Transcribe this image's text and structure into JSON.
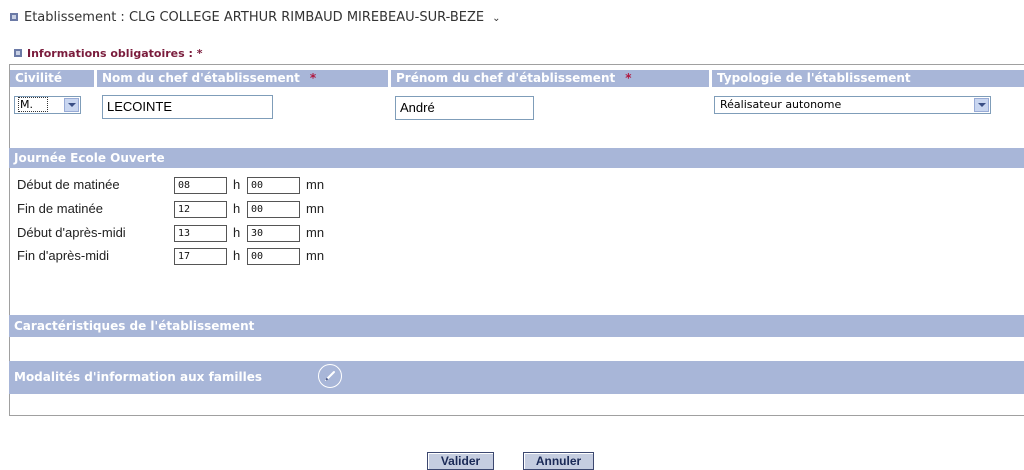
{
  "header": {
    "title": "Etablissement : CLG COLLEGE ARTHUR RIMBAUD MIREBEAU-SUR-BEZE",
    "required_note": "Informations obligatoires : *"
  },
  "columns": {
    "civilite": "Civilité",
    "nom": "Nom du chef d'établissement",
    "prenom": "Prénom du chef d'établissement",
    "typologie": "Typologie de l'établissement",
    "required_mark": "*"
  },
  "form": {
    "civilite": "M.",
    "nom": "LECOINTE",
    "prenom": "André",
    "typologie": "Réalisateur autonome"
  },
  "journee": {
    "title": "Journée Ecole Ouverte",
    "hour_unit": "h",
    "min_unit": "mn",
    "rows": [
      {
        "label": "Début de matinée",
        "h": "08",
        "m": "00"
      },
      {
        "label": "Fin de matinée",
        "h": "12",
        "m": "00"
      },
      {
        "label": "Début d'après-midi",
        "h": "13",
        "m": "30"
      },
      {
        "label": "Fin d'après-midi",
        "h": "17",
        "m": "00"
      }
    ]
  },
  "sections": {
    "caracteristiques": "Caractéristiques de l'établissement",
    "modalites": "Modalités d'information aux familles"
  },
  "buttons": {
    "valider": "Valider",
    "annuler": "Annuler"
  },
  "colors": {
    "header_band": "#a8b6d8",
    "required_text": "#7a1c3c"
  }
}
